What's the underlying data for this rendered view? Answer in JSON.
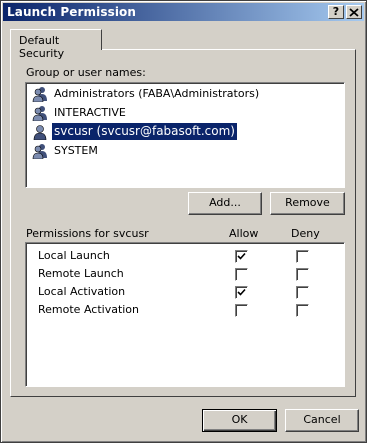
{
  "window": {
    "title": "Launch Permission",
    "help_label": "?",
    "close_label": "✕"
  },
  "tabs": [
    {
      "label": "Default Security"
    }
  ],
  "groups": {
    "label": "Group or user names:",
    "items": [
      {
        "name": "Administrators (FABA\\Administrators)",
        "icon": "users-group-icon",
        "selected": false
      },
      {
        "name": "INTERACTIVE",
        "icon": "users-group-icon",
        "selected": false
      },
      {
        "name": "svcusr (svcusr@fabasoft.com)",
        "icon": "user-icon",
        "selected": true
      },
      {
        "name": "SYSTEM",
        "icon": "users-group-icon",
        "selected": false
      }
    ],
    "add_label": "Add...",
    "remove_label": "Remove"
  },
  "permissions": {
    "label": "Permissions for svcusr",
    "allow_header": "Allow",
    "deny_header": "Deny",
    "rows": [
      {
        "name": "Local Launch",
        "allow": true,
        "deny": false
      },
      {
        "name": "Remote Launch",
        "allow": false,
        "deny": false
      },
      {
        "name": "Local Activation",
        "allow": true,
        "deny": false
      },
      {
        "name": "Remote Activation",
        "allow": false,
        "deny": false
      }
    ]
  },
  "footer": {
    "ok_label": "OK",
    "cancel_label": "Cancel"
  }
}
